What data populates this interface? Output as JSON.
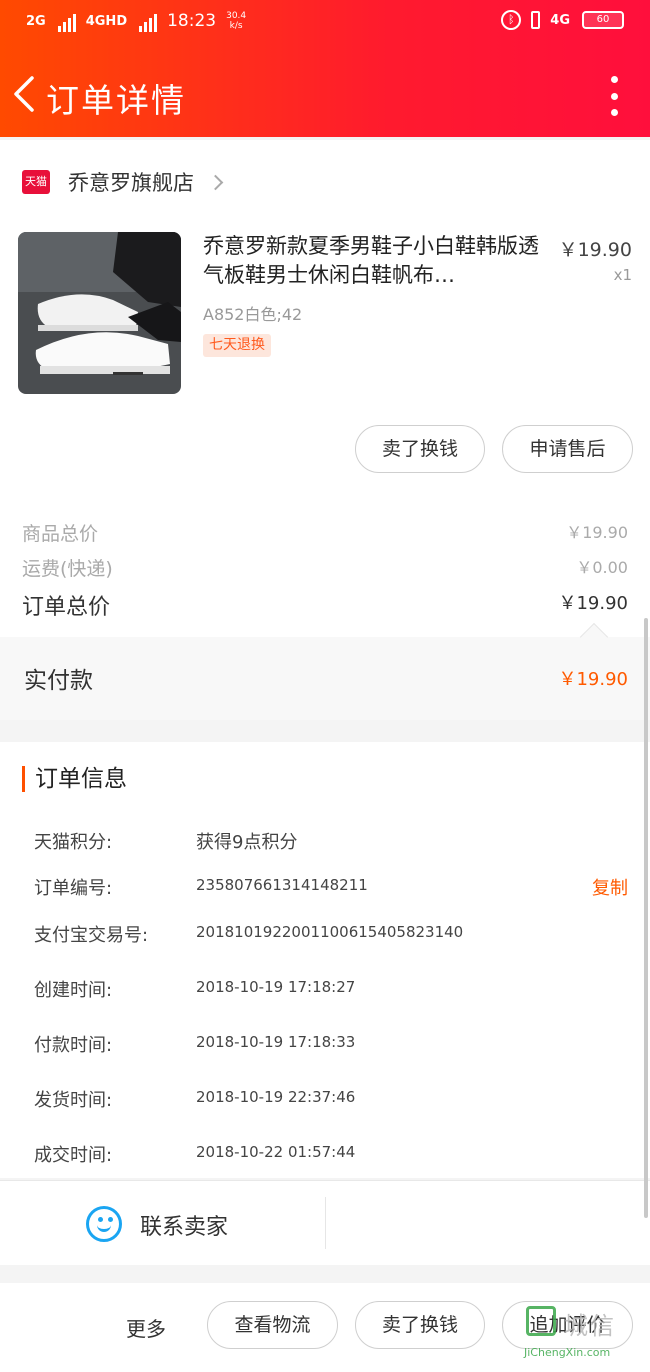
{
  "status_bar": {
    "net1": "2G",
    "net2": "4GHD",
    "time": "18:23",
    "speed": "30.4",
    "speed_unit": "k/s",
    "bt_icon": "bluetooth-icon",
    "net3": "4G",
    "battery": "60"
  },
  "header": {
    "title": "订单详情",
    "back_icon": "back-arrow-icon",
    "more_icon": "more-vertical-icon"
  },
  "store": {
    "badge": "天猫",
    "name": "乔意罗旗舰店"
  },
  "product": {
    "name": "乔意罗新款夏季男鞋子小白鞋韩版透气板鞋男士休闲白鞋帆布…",
    "price": "￥19.90",
    "qty": "x1",
    "sku": "A852白色;42",
    "tag": "七天退换"
  },
  "product_actions": {
    "resell": "卖了换钱",
    "after_sale": "申请售后"
  },
  "totals": {
    "goods_label": "商品总价",
    "goods_value": "￥19.90",
    "shipping_label": "运费(快递)",
    "shipping_value": "￥0.00",
    "order_label": "订单总价",
    "order_value": "￥19.90",
    "paid_label": "实付款",
    "paid_value": "￥19.90"
  },
  "order_info": {
    "title": "订单信息",
    "points_label": "天猫积分:",
    "points_value": "获得9点积分",
    "order_no_label": "订单编号:",
    "order_no_value": "235807661314148211",
    "copy": "复制",
    "alipay_label": "支付宝交易号:",
    "alipay_value": "2018101922001100615405823140",
    "created_label": "创建时间:",
    "created_value": "2018-10-19 17:18:27",
    "paid_label": "付款时间:",
    "paid_value": "2018-10-19 17:18:33",
    "shipped_label": "发货时间:",
    "shipped_value": "2018-10-19 22:37:46",
    "deal_label": "成交时间:",
    "deal_value": "2018-10-22 01:57:44"
  },
  "contact": {
    "label": "联系卖家"
  },
  "bottom": {
    "more": "更多",
    "logistics": "查看物流",
    "resell": "卖了换钱",
    "review": "追加评价"
  },
  "watermark": {
    "cn": "城信",
    "en": "JiChengXin.com"
  }
}
